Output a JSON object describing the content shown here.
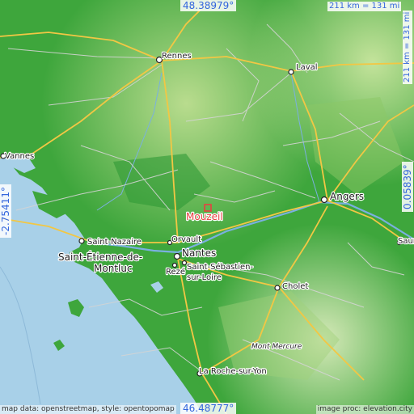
{
  "coords": {
    "top": "48.38979°",
    "bottom": "46.48777°",
    "left": "-2.75411°",
    "right": "0.05839°"
  },
  "scale": {
    "horizontal": "211 km = 131 mi",
    "vertical": "211 km = 131 mi"
  },
  "highlight": {
    "name": "Mouzeil",
    "color": "#e84040"
  },
  "places": [
    {
      "name": "Rennes"
    },
    {
      "name": "Laval"
    },
    {
      "name": "Vannes"
    },
    {
      "name": "Angers"
    },
    {
      "name": "Saint-Nazaire"
    },
    {
      "name": "Saint-Étienne-de-"
    },
    {
      "name": "Montluc"
    },
    {
      "name": "Orvault"
    },
    {
      "name": "Nantes"
    },
    {
      "name": "Rezé"
    },
    {
      "name": "Saint-Sébastien-"
    },
    {
      "name": "sur-Loire"
    },
    {
      "name": "Cholet"
    },
    {
      "name": "Mont Mercure"
    },
    {
      "name": "La Roche-sur-Yon"
    },
    {
      "name": "Saur"
    }
  ],
  "credits": {
    "left": "map data: openstreetmap, style: opentopomap",
    "right": "image proc: elevation.city"
  },
  "colors": {
    "sea": "#a8d0e8",
    "lowland": "#3aa63a",
    "upland": "#a6d27a",
    "road_major": "#f2c744",
    "road_minor": "#cfcfcf",
    "river": "#7ab0e0"
  }
}
